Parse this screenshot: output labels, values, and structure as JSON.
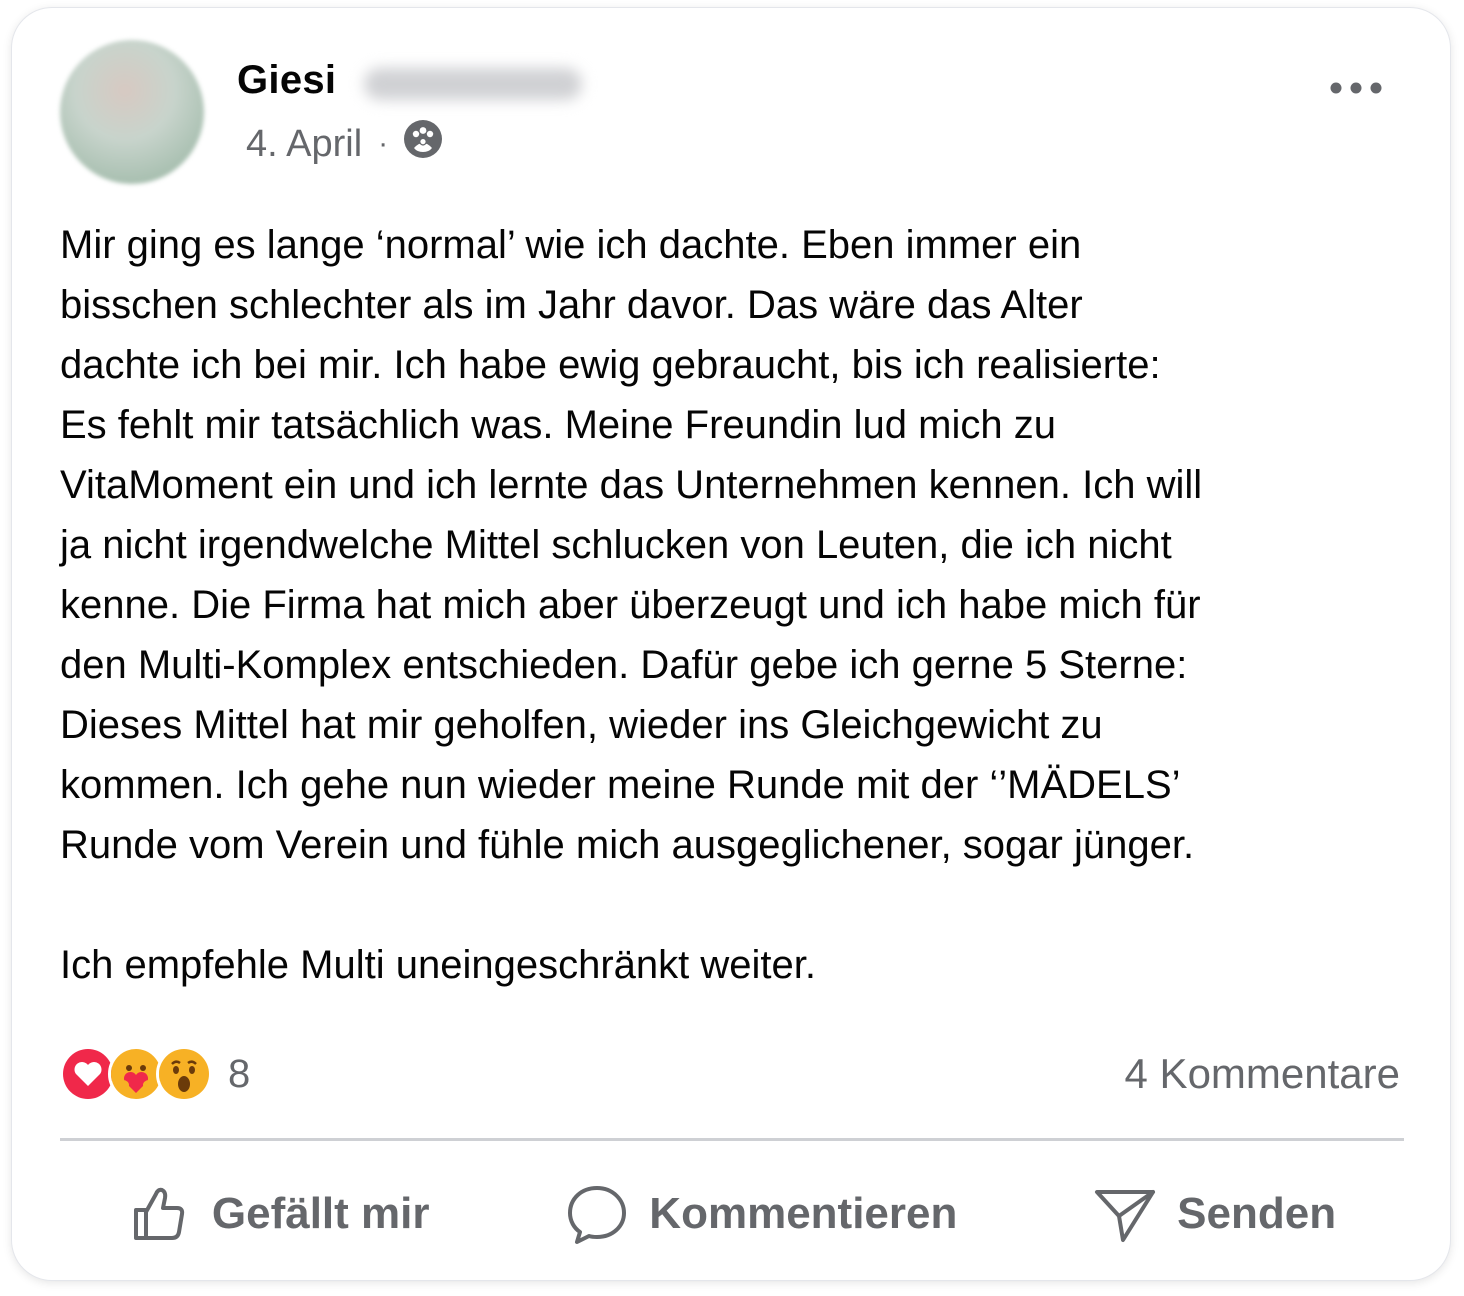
{
  "post": {
    "author_first_name": "Giesi",
    "date": "4. April",
    "separator": "·",
    "audience_icon": "group-audience-icon",
    "menu_icon": "more-options-icon",
    "paragraph_1": "Mir ging es lange ‘normal’ wie ich dachte. Eben immer ein\nbisschen schlechter als im Jahr davor. Das wäre das Alter\ndachte ich bei mir. Ich habe ewig gebraucht, bis ich realisierte:\nEs fehlt mir tatsächlich was. Meine Freundin lud mich zu\nVitaMoment ein und ich lernte das Unternehmen kennen. Ich will\nja nicht irgendwelche Mittel schlucken von Leuten, die ich nicht\nkenne. Die Firma hat mich aber überzeugt und ich habe mich für\nden Multi-Komplex entschieden. Dafür gebe ich gerne 5 Sterne:\nDieses Mittel hat mir geholfen, wieder ins Gleichgewicht zu\nkommen. Ich gehe nun wieder meine Runde mit der ‘’MÄDELS’\nRunde vom Verein und fühle mich ausgeglichener, sogar jünger.",
    "paragraph_2": "Ich empfehle Multi uneingeschränkt weiter."
  },
  "stats": {
    "reaction_icons": [
      "love-reaction-icon",
      "care-reaction-icon",
      "wow-reaction-icon"
    ],
    "reaction_count": "8",
    "comments_count": "4 Kommentare"
  },
  "actions": {
    "like_label": "Gefällt mir",
    "comment_label": "Kommentieren",
    "send_label": "Senden"
  },
  "colors": {
    "text_primary": "#050505",
    "text_secondary": "#65676b",
    "divider": "#ced0d4",
    "love_red": "#f0284a",
    "reaction_yellow": "#f7b125"
  }
}
